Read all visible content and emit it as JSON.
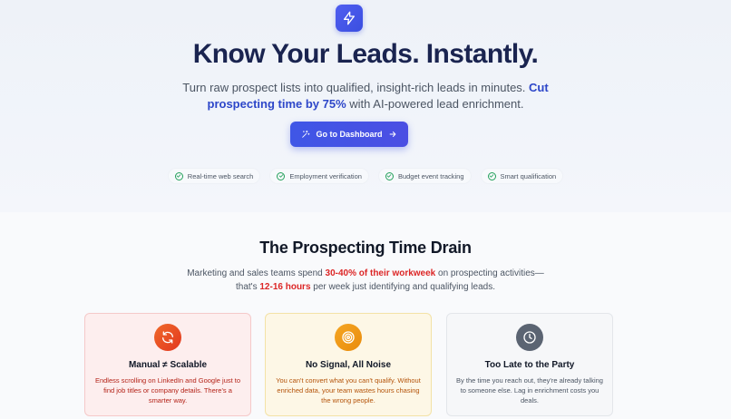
{
  "hero": {
    "title": "Know Your Leads. Instantly.",
    "subtitle_part1": "Turn raw prospect lists into qualified, insight-rich leads in minutes. ",
    "subtitle_highlight": "Cut prospecting time by 75%",
    "subtitle_part2": " with AI-powered lead enrichment.",
    "cta_label": "Go to Dashboard",
    "logo_icon": "lightning-bolt-icon",
    "cta_icon": "sparkle-icon",
    "cta_arrow_icon": "arrow-right-icon",
    "accent_color": "#3f56e6"
  },
  "features": [
    {
      "label": "Real-time web search",
      "icon": "check-circle-icon"
    },
    {
      "label": "Employment verification",
      "icon": "check-circle-icon"
    },
    {
      "label": "Budget event tracking",
      "icon": "check-circle-icon"
    },
    {
      "label": "Smart qualification",
      "icon": "check-circle-icon"
    }
  ],
  "problem": {
    "title": "The Prospecting Time Drain",
    "sub_part1": "Marketing and sales teams spend ",
    "sub_highlight1": "30-40% of their workweek",
    "sub_part2": " on prospecting activities— that's ",
    "sub_highlight2": "12-16 hours",
    "sub_part3": " per week just identifying and qualifying leads.",
    "highlight_color": "#dc2626",
    "cards": [
      {
        "icon": "refresh-icon",
        "title": "Manual ≠ Scalable",
        "body": "Endless scrolling on LinkedIn and Google just to find job titles or company details. There's a smarter way.",
        "color": "#e2361f"
      },
      {
        "icon": "target-icon",
        "title": "No Signal, All Noise",
        "body": "You can't convert what you can't qualify. Without enriched data, your team wastes hours chasing the wrong people.",
        "color": "#e98b0c"
      },
      {
        "icon": "clock-icon",
        "title": "Too Late to the Party",
        "body": "By the time you reach out, they're already talking to someone else. Lag in enrichment costs you deals.",
        "color": "#5b6472"
      }
    ]
  }
}
